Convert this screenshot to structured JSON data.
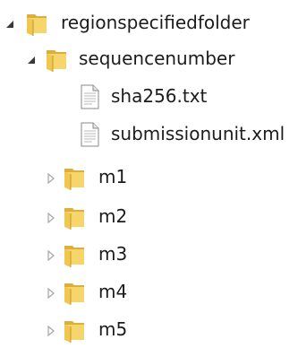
{
  "tree": {
    "root": {
      "label": "regionspecifiedfolder",
      "expanded": true,
      "icon": "folder-icon"
    },
    "sequence": {
      "label": "sequencenumber",
      "expanded": true,
      "icon": "folder-icon"
    },
    "files": [
      {
        "label": "sha256.txt",
        "icon": "text-file-icon"
      },
      {
        "label": "submissionunit.xml",
        "icon": "text-file-icon"
      }
    ],
    "modules": [
      {
        "label": "m1",
        "expanded": false,
        "icon": "folder-icon"
      },
      {
        "label": "m2",
        "expanded": false,
        "icon": "folder-icon"
      },
      {
        "label": "m3",
        "expanded": false,
        "icon": "folder-icon"
      },
      {
        "label": "m4",
        "expanded": false,
        "icon": "folder-icon"
      },
      {
        "label": "m5",
        "expanded": false,
        "icon": "folder-icon"
      }
    ]
  },
  "colors": {
    "text": "#1c1c1c",
    "folder_front": "#f6d66b",
    "folder_back": "#dcae3f",
    "expanded_arrow": "#3a3a3a",
    "collapsed_arrow": "#a6a6a6"
  }
}
